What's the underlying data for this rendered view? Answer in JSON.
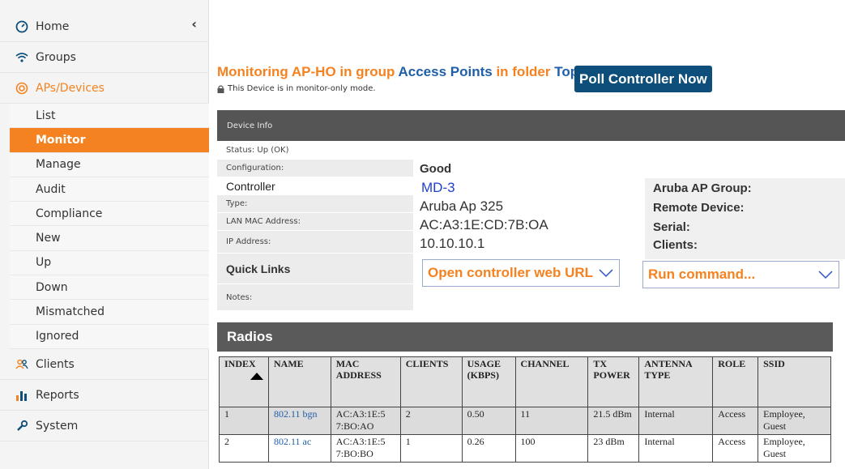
{
  "sidebar": {
    "collapse_icon": "chevron-left-icon",
    "top_items": [
      {
        "label": "Home",
        "icon": "dashboard-icon"
      },
      {
        "label": "Groups",
        "icon": "wifi-icon"
      },
      {
        "label": "APs/Devices",
        "icon": "ap-icon"
      }
    ],
    "sub_items": [
      {
        "label": "List"
      },
      {
        "label": "Monitor"
      },
      {
        "label": "Manage"
      },
      {
        "label": "Audit"
      },
      {
        "label": "Compliance"
      },
      {
        "label": "New"
      },
      {
        "label": "Up"
      },
      {
        "label": "Down"
      },
      {
        "label": "Mismatched"
      },
      {
        "label": "Ignored"
      }
    ],
    "bottom_items": [
      {
        "label": "Clients",
        "icon": "users-icon"
      },
      {
        "label": "Reports",
        "icon": "bar-chart-icon"
      },
      {
        "label": "System",
        "icon": "wrench-icon"
      }
    ]
  },
  "header": {
    "title_prefix": "Monitoring AP-HO in group ",
    "group_link": "Access Points",
    "title_mid": " in folder ",
    "folder_link": "Top",
    "poll_button": "Poll  Controller Now",
    "mode_note": "This Device is in monitor-only mode."
  },
  "device_info": {
    "panel_title": "Device Info",
    "status": "Status: Up (OK)",
    "configuration_label": "Configuration:",
    "configuration_value": "Good",
    "controller_label": "Controller",
    "controller_value": "MD-3",
    "type_label": "Type:",
    "type_value": "Aruba Ap 325",
    "lan_mac_label": "LAN MAC Address:",
    "lan_mac_value": "AC:A3:1E:CD:7B:OA",
    "ip_label": "IP Address:",
    "ip_value": "10.10.10.1",
    "quick_links_label": "Quick Links",
    "notes_label": "Notes:",
    "aruba_ap_group_label": "Aruba AP Group:",
    "remote_device_label": "Remote Device:",
    "serial_label": "Serial:",
    "clients_label": "Clients:",
    "open_controller_dropdown": "Open controller web URL",
    "run_command_dropdown": "Run command..."
  },
  "radios": {
    "title": "Radios",
    "columns": [
      "INDEX",
      "NAME",
      "MAC ADDRESS",
      "CLIENTS",
      "USAGE (KBPS)",
      "CHANNEL",
      "TX POWER",
      "ANTENNA TYPE",
      "ROLE",
      "SSID"
    ],
    "rows": [
      {
        "index": "1",
        "name": "802.11 bgn",
        "mac": "AC:A3:1E:5 7:BO:AO",
        "clients": "2",
        "usage": "0.50",
        "channel": "11",
        "tx_power": "21.5 dBm",
        "antenna": "Internal",
        "role": "Access",
        "ssid": "Employee, Guest"
      },
      {
        "index": "2",
        "name": "802.11 ac",
        "mac": "AC:A3:1E:5 7:BO:BO",
        "clients": "1",
        "usage": "0.26",
        "channel": "100",
        "tx_power": "23 dBm",
        "antenna": "Internal",
        "role": "Access",
        "ssid": "Employee, Guest"
      }
    ]
  },
  "colors": {
    "accent": "#f58220",
    "link": "#1f5fa8",
    "poll_button_bg": "#0d4f7a",
    "panel_header_bg": "#555555"
  }
}
